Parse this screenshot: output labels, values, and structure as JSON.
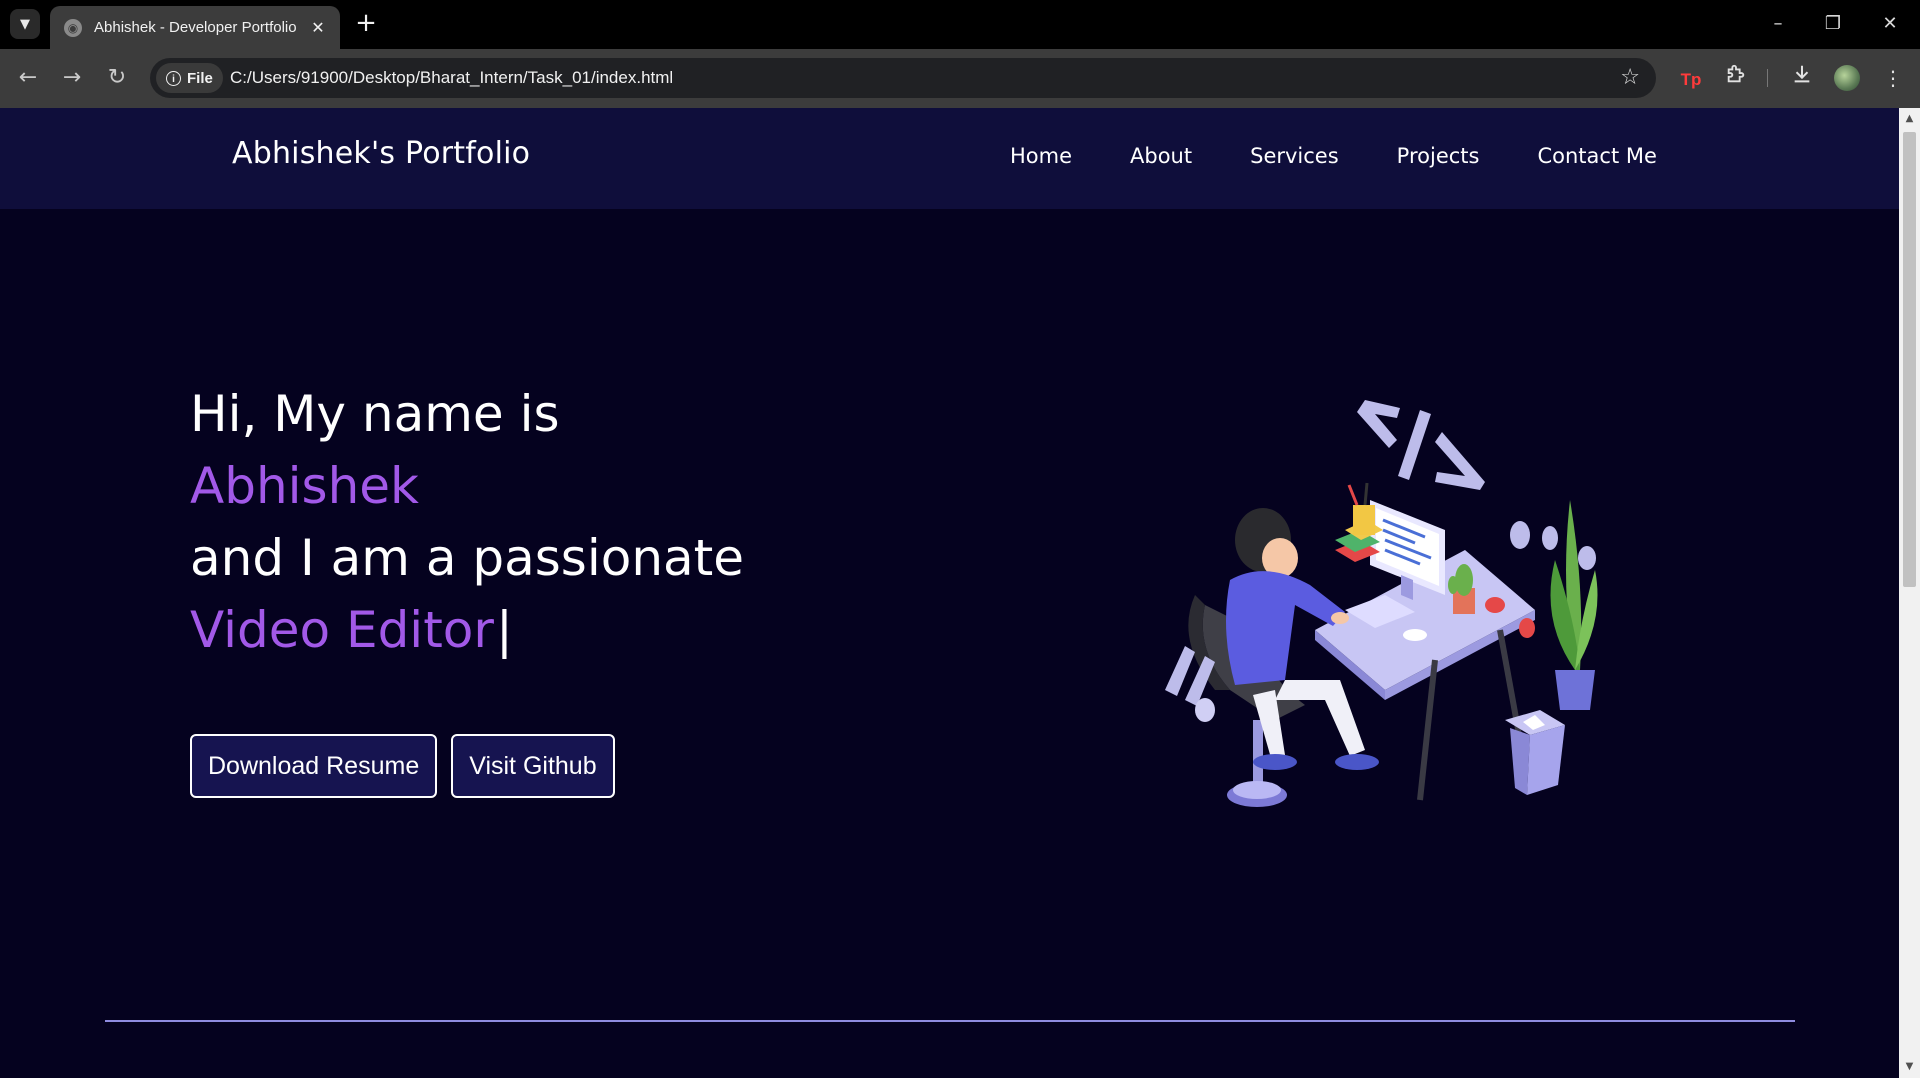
{
  "browser": {
    "tab_title": "Abhishek - Developer Portfolio",
    "url_chip": "File",
    "url": "C:/Users/91900/Desktop/Bharat_Intern/Task_01/index.html",
    "extension_label": "Tp"
  },
  "nav": {
    "brand": "Abhishek's Portfolio",
    "links": [
      "Home",
      "About",
      "Services",
      "Projects",
      "Contact Me"
    ]
  },
  "hero": {
    "line1": "Hi, My name is",
    "name": "Abhishek",
    "line3": "and I am a passionate",
    "role": "Video Editor",
    "cursor": "|",
    "buttons": {
      "resume": "Download Resume",
      "github": "Visit Github"
    }
  },
  "colors": {
    "page_bg": "#05021f",
    "navbar_bg": "#0f0e3b",
    "accent": "#a259e8",
    "button_bg": "#161450",
    "divider": "#8f8ce0"
  },
  "icons": {
    "illustration": "developer-at-desk-illustration"
  }
}
